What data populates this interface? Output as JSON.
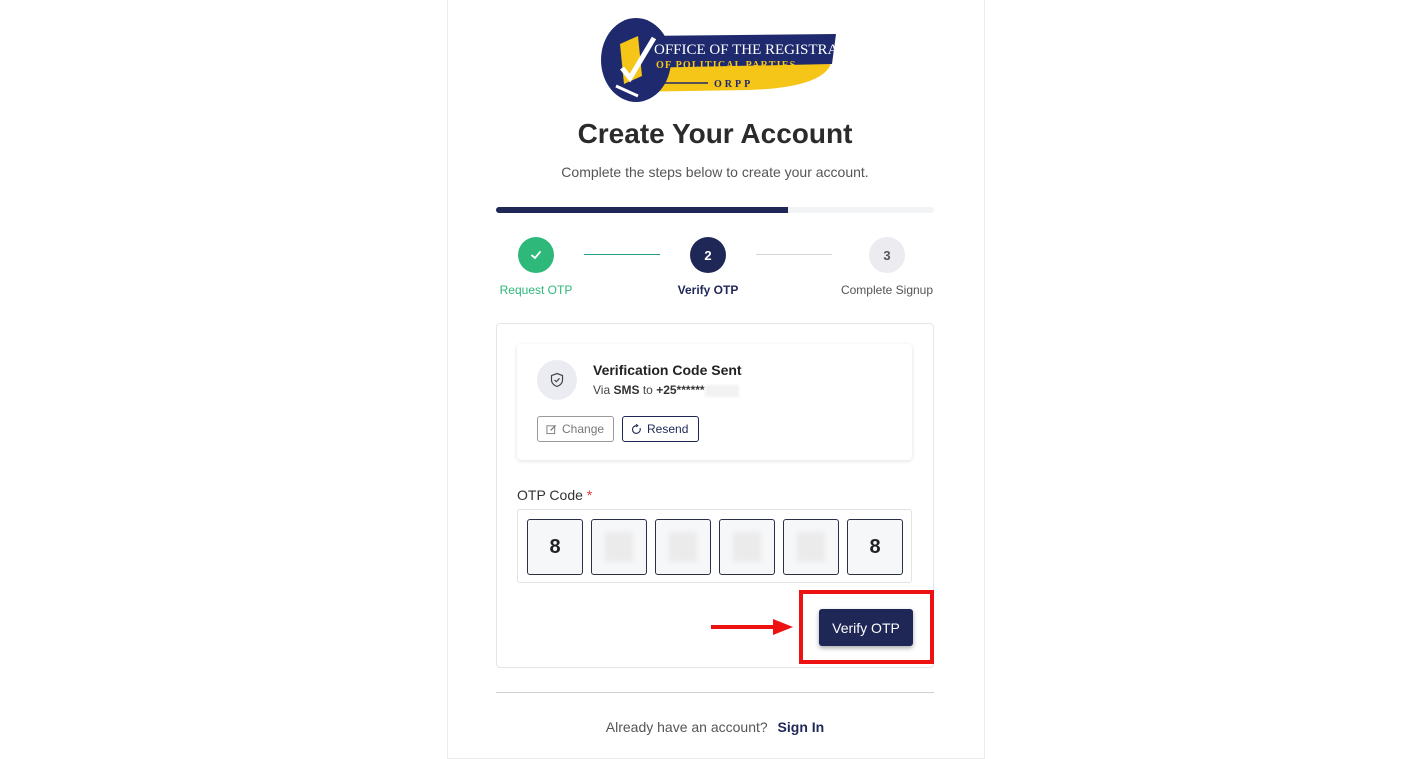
{
  "logo": {
    "line1": "OFFICE OF THE REGISTRAR",
    "line2": "OF POLITICAL PARTIES",
    "abbr": "ORPP",
    "colors": {
      "navy": "#1f2a6e",
      "gold": "#f5c518"
    }
  },
  "header": {
    "title": "Create Your Account",
    "subtitle": "Complete the steps below to create your account."
  },
  "progress": {
    "percent": 66.7
  },
  "steps": [
    {
      "number": "1",
      "label": "Request OTP",
      "status": "completed",
      "icon": "check-icon"
    },
    {
      "number": "2",
      "label": "Verify OTP",
      "status": "active"
    },
    {
      "number": "3",
      "label": "Complete Signup",
      "status": "pending"
    }
  ],
  "verification": {
    "icon": "shield-icon",
    "title": "Verification Code Sent",
    "via_prefix": "Via",
    "method": "SMS",
    "to_word": "to",
    "phone": "+25******",
    "change_label": "Change",
    "resend_label": "Resend"
  },
  "otp": {
    "label": "OTP Code",
    "required_mark": "*",
    "digits": [
      "8",
      "",
      "",
      "",
      "",
      "8"
    ]
  },
  "actions": {
    "verify_label": "Verify OTP"
  },
  "footer": {
    "prompt": "Already have an account?",
    "link": "Sign In"
  },
  "colors": {
    "primary": "#1f2757",
    "success": "#2eb87a",
    "highlight": "#ee1111"
  }
}
